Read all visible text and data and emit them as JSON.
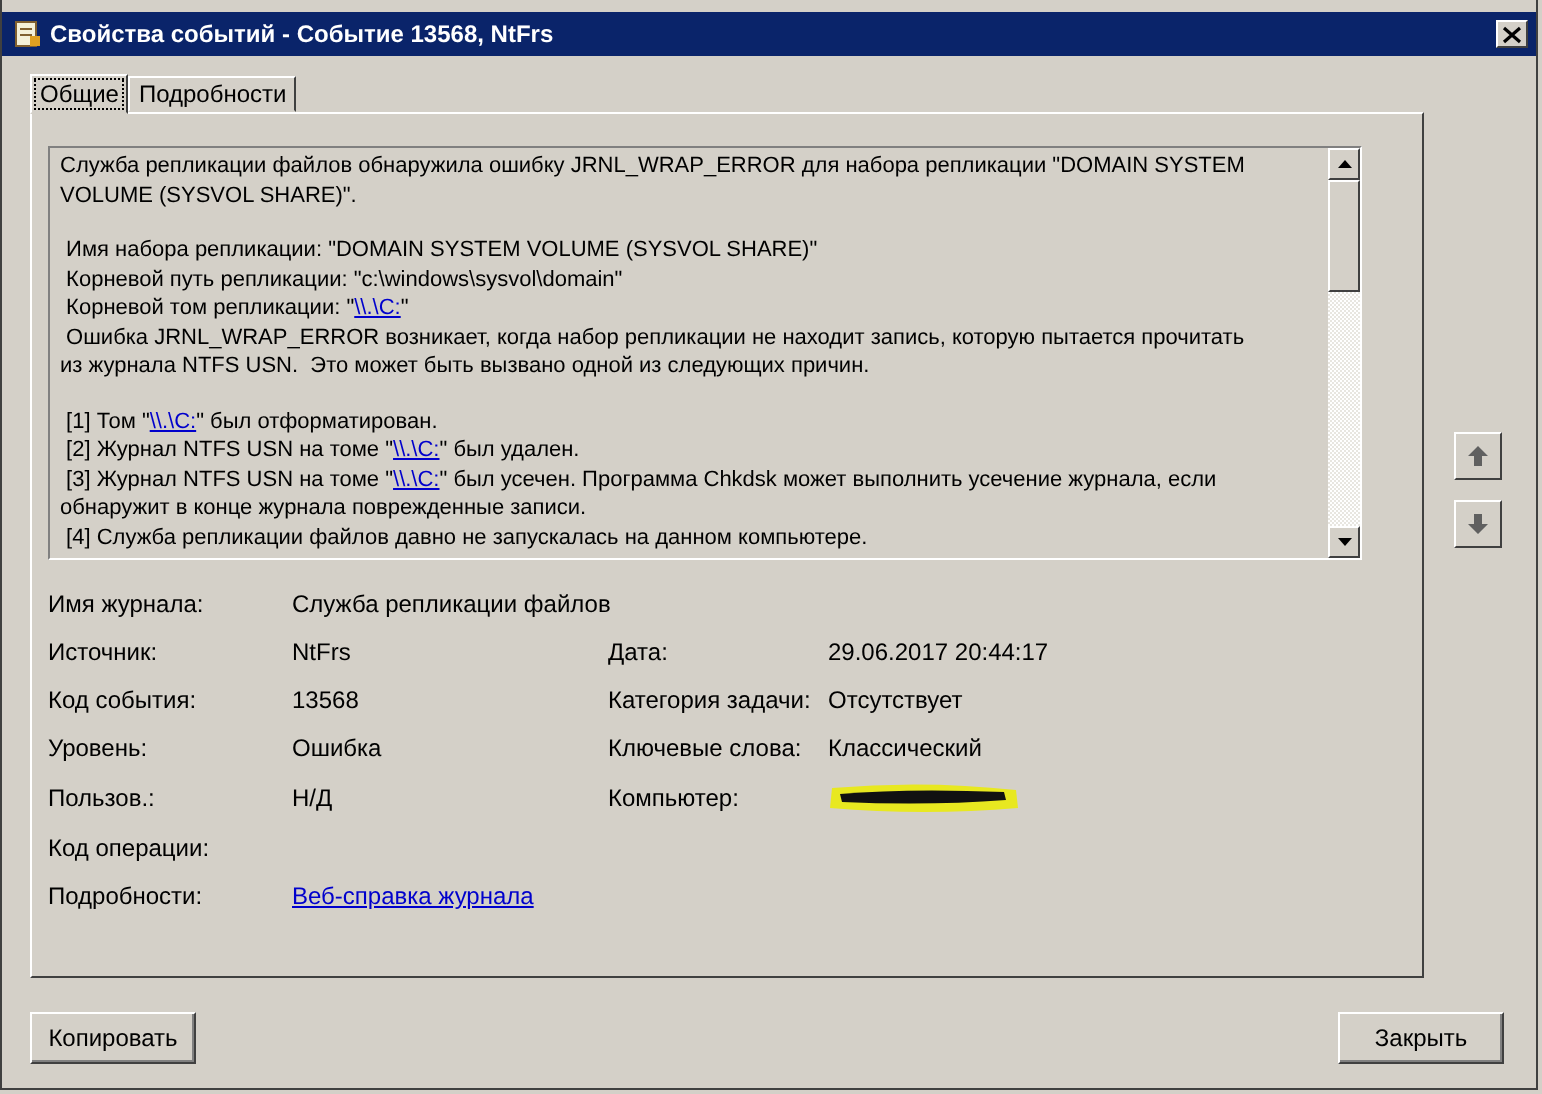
{
  "window": {
    "title": "Свойства событий - Событие 13568, NtFrs"
  },
  "tabs": [
    {
      "label": "Общие",
      "selected": true
    },
    {
      "label": "Подробности",
      "selected": false
    }
  ],
  "description": {
    "paragraphs": [
      [
        [
          {
            "kind": "text",
            "text": "Служба репликации файлов обнаружила ошибку JRNL_WRAP_ERROR для набора репликации \"DOMAIN SYSTEM"
          }
        ],
        [
          {
            "kind": "text",
            "text": "VOLUME (SYSVOL SHARE)\"."
          }
        ]
      ],
      [
        [
          {
            "kind": "text",
            "text": " Имя набора репликации: \"DOMAIN SYSTEM VOLUME (SYSVOL SHARE)\""
          }
        ],
        [
          {
            "kind": "text",
            "text": " Корневой путь репликации: \"c:\\windows\\sysvol\\domain\""
          }
        ],
        [
          {
            "kind": "text",
            "text": " Корневой том репликации: \""
          },
          {
            "kind": "link",
            "text": "\\\\.\\C:"
          },
          {
            "kind": "text",
            "text": "\""
          }
        ],
        [
          {
            "kind": "text",
            "text": " Ошибка JRNL_WRAP_ERROR возникает, когда набор репликации не находит запись, которую пытается прочитать"
          }
        ],
        [
          {
            "kind": "text",
            "text": "из журнала NTFS USN.  Это может быть вызвано одной из следующих причин."
          }
        ]
      ],
      [
        [
          {
            "kind": "text",
            "text": " [1] Том \""
          },
          {
            "kind": "link",
            "text": "\\\\.\\C:"
          },
          {
            "kind": "text",
            "text": "\" был отформатирован."
          }
        ],
        [
          {
            "kind": "text",
            "text": " [2] Журнал NTFS USN на томе \""
          },
          {
            "kind": "link",
            "text": "\\\\.\\C:"
          },
          {
            "kind": "text",
            "text": "\" был удален."
          }
        ],
        [
          {
            "kind": "text",
            "text": " [3] Журнал NTFS USN на томе \""
          },
          {
            "kind": "link",
            "text": "\\\\.\\C:"
          },
          {
            "kind": "text",
            "text": "\" был усечен. Программа Chkdsk может выполнить усечение журнала, если"
          }
        ],
        [
          {
            "kind": "text",
            "text": "обнаружит в конце журнала поврежденные записи."
          }
        ],
        [
          {
            "kind": "text",
            "text": " [4] Служба репликации файлов давно не запускалась на данном компьютере."
          }
        ]
      ]
    ]
  },
  "rows": [
    {
      "left": {
        "label": "Имя журнала:",
        "kind": "text",
        "value": "Служба репликации файлов"
      }
    },
    {
      "left": {
        "label": "Источник:",
        "kind": "text",
        "value": "NtFrs"
      },
      "right": {
        "label": "Дата:",
        "kind": "text",
        "value": "29.06.2017 20:44:17"
      }
    },
    {
      "left": {
        "label": "Код события:",
        "kind": "text",
        "value": "13568"
      },
      "right": {
        "label": "Категория задачи:",
        "kind": "text",
        "value": "Отсутствует"
      }
    },
    {
      "left": {
        "label": "Уровень:",
        "kind": "text",
        "value": "Ошибка"
      },
      "right": {
        "label": "Ключевые слова:",
        "kind": "text",
        "value": "Классический"
      }
    },
    {
      "left": {
        "label": "Пользов.:",
        "kind": "text",
        "value": "Н/Д"
      },
      "right": {
        "label": "Компьютер:",
        "kind": "redacted"
      }
    },
    {
      "left": {
        "label": "Код операции:",
        "kind": "text"
      }
    },
    {
      "left": {
        "label": "Подробности:",
        "kind": "link",
        "value": "Веб-справка журнала "
      }
    }
  ],
  "buttons": {
    "copy": "Копировать",
    "close": "Закрыть"
  }
}
